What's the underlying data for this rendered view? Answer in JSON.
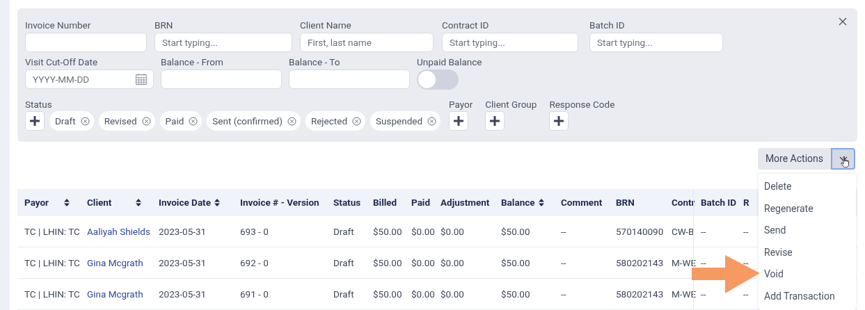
{
  "filters": [
    {
      "kind": "input",
      "label": "Invoice Number"
    },
    {
      "kind": "input",
      "label": "BRN",
      "placeholder": "Start typing..."
    },
    {
      "kind": "input",
      "label": "Client Name",
      "placeholder": "First, last name"
    },
    {
      "kind": "input",
      "label": "Contract ID",
      "placeholder": "Start typing..."
    },
    {
      "kind": "input",
      "label": "Batch ID",
      "placeholder": "Start typing..."
    },
    {
      "kind": "date",
      "label": "Visit Cut-Off Date",
      "placeholder": "YYYY-MM-DD"
    },
    {
      "kind": "input",
      "label": "Balance - From"
    },
    {
      "kind": "input",
      "label": "Balance - To"
    },
    {
      "kind": "toggle",
      "label": "Unpaid Balance",
      "on": false
    }
  ],
  "status": {
    "label": "Status",
    "chips": [
      "Draft",
      "Revised",
      "Paid",
      "Sent (confirmed)",
      "Rejected",
      "Suspended"
    ]
  },
  "add_filters": [
    "Payor",
    "Client Group",
    "Response Code"
  ],
  "more_actions": {
    "label": "More Actions",
    "open": true,
    "items": [
      "Delete",
      "Regenerate",
      "Send",
      "Revise",
      "Void",
      "Add Transaction"
    ]
  },
  "table": {
    "columns": [
      {
        "label": "Payor",
        "sortable": true
      },
      {
        "label": "Client",
        "sortable": true
      },
      {
        "label": "Invoice Date",
        "sortable": true
      },
      {
        "label": "Invoice # - Version",
        "sortable": false
      },
      {
        "label": "Status",
        "sortable": false
      },
      {
        "label": "Billed",
        "sortable": false
      },
      {
        "label": "Paid",
        "sortable": false
      },
      {
        "label": "Adjustment",
        "sortable": false
      },
      {
        "label": "Balance",
        "sortable": true
      },
      {
        "label": "Comment",
        "sortable": false
      },
      {
        "label": "BRN",
        "sortable": false
      },
      {
        "label": "Contr",
        "sortable": false
      },
      {
        "label": "Batch ID",
        "sortable": false
      },
      {
        "label": "R",
        "sortable": false
      }
    ],
    "rows": [
      [
        "TC | LHIN: TC",
        "Aaliyah Shields",
        "2023-05-31",
        "693 - 0",
        "Draft",
        "$50.00",
        "$0.00",
        "$0.00",
        "$50.00",
        "--",
        "570140090",
        "CW-B",
        "--",
        "--"
      ],
      [
        "TC | LHIN: TC",
        "Gina Mcgrath",
        "2023-05-31",
        "692 - 0",
        "Draft",
        "$50.00",
        "$0.00",
        "$0.00",
        "$50.00",
        "--",
        "580202143",
        "M-WE",
        "--",
        "--"
      ],
      [
        "TC | LHIN: TC",
        "Gina Mcgrath",
        "2023-05-31",
        "691 - 0",
        "Draft",
        "$50.00",
        "$0.00",
        "$0.00",
        "$50.00",
        "--",
        "580202143",
        "M-WE",
        "--",
        "--"
      ]
    ]
  }
}
